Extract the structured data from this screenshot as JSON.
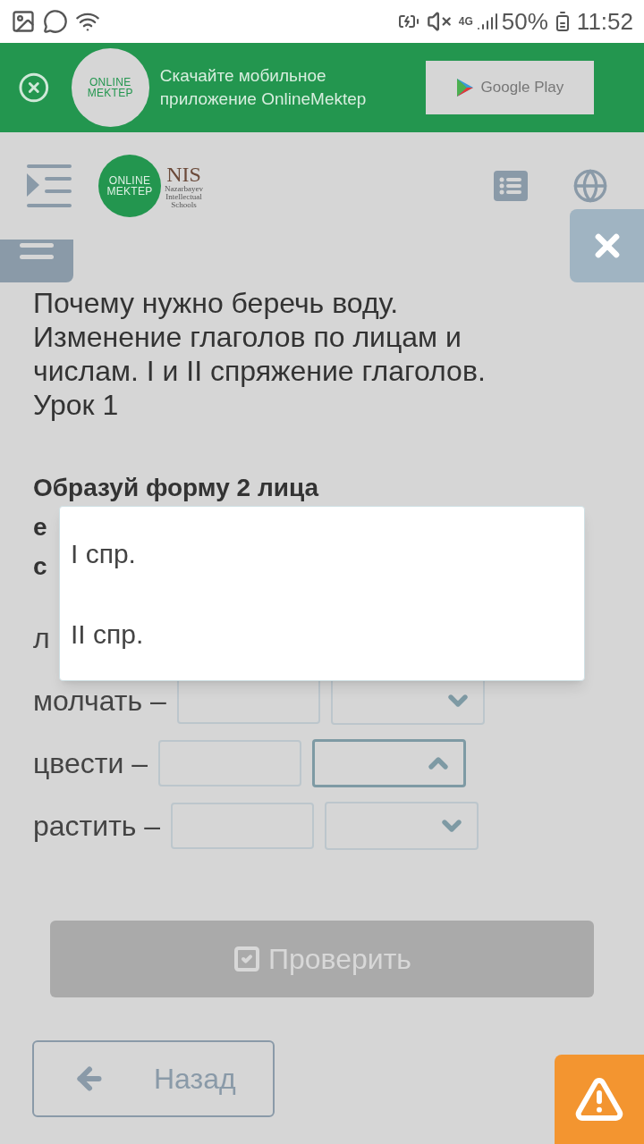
{
  "status_bar": {
    "network": "4G",
    "battery": "50%",
    "time": "11:52"
  },
  "app_banner": {
    "logo": [
      "ONLINE",
      "MEKTEP"
    ],
    "text": "Скачайте мобильное приложение OnlineMektep",
    "store_button": "Google Play"
  },
  "header": {
    "logo": [
      "ONLINE",
      "MEKTEP"
    ],
    "partner_logo": {
      "name": "NIS",
      "subtitle": [
        "Nazarbayev",
        "Intellectual",
        "Schools"
      ]
    }
  },
  "lesson_title": "Почему нужно беречь воду. Изменение глаголов по лицам и числам. I и II спряжение глаголов. Урок 1",
  "instruction_lines": [
    "Образуй форму 2 лица",
    "е",
    "с"
  ],
  "rows": [
    {
      "kind": "partial",
      "word": "л"
    },
    {
      "kind": "exercise",
      "word": "молчать –",
      "expanded": false
    },
    {
      "kind": "exercise",
      "word": "цвести –",
      "expanded": true
    },
    {
      "kind": "exercise",
      "word": "растить –",
      "expanded": false
    }
  ],
  "dropdown": {
    "options": [
      {
        "label": "I спр.",
        "selected": false
      },
      {
        "label": "II спр.",
        "selected": false
      }
    ]
  },
  "check_button": {
    "label": "Проверить",
    "disabled": true
  },
  "back_button": {
    "label": "Назад"
  }
}
